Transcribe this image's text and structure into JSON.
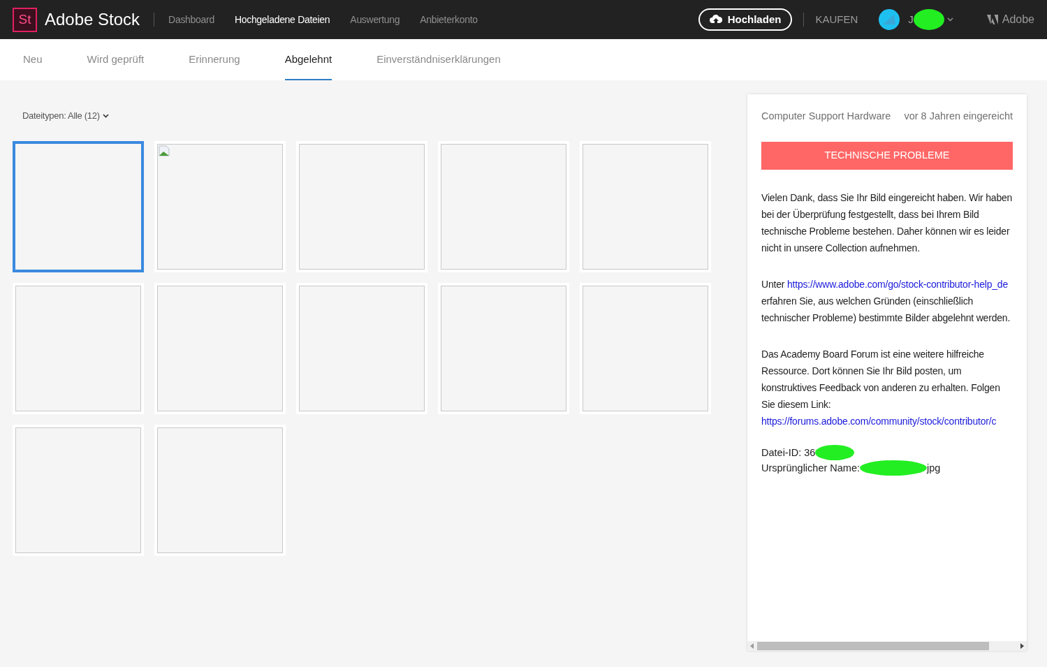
{
  "header": {
    "logo_mark": "St",
    "brand": "Adobe Stock",
    "nav": [
      {
        "label": "Dashboard",
        "selected": false
      },
      {
        "label": "Hochgeladene Dateien",
        "selected": true
      },
      {
        "label": "Auswertung",
        "selected": false
      },
      {
        "label": "Anbieterkonto",
        "selected": false
      }
    ],
    "upload_button": "Hochladen",
    "buy_link": "KAUFEN",
    "user_initial": "J",
    "adobe_link": "Adobe"
  },
  "tabs": [
    {
      "label": "Neu",
      "selected": false
    },
    {
      "label": "Wird geprüft",
      "selected": false
    },
    {
      "label": "Erinnerung",
      "selected": false
    },
    {
      "label": "Abgelehnt",
      "selected": true
    },
    {
      "label": "Einverständniserklärungen",
      "selected": false
    }
  ],
  "filter": "Dateitypen: Alle (12)",
  "tiles": [
    {
      "selected": true,
      "broken_image": false
    },
    {
      "selected": false,
      "broken_image": true
    },
    {
      "selected": false,
      "broken_image": false
    },
    {
      "selected": false,
      "broken_image": false
    },
    {
      "selected": false,
      "broken_image": false
    },
    {
      "selected": false,
      "broken_image": false
    },
    {
      "selected": false,
      "broken_image": false
    },
    {
      "selected": false,
      "broken_image": false
    },
    {
      "selected": false,
      "broken_image": false
    },
    {
      "selected": false,
      "broken_image": false
    },
    {
      "selected": false,
      "broken_image": false
    },
    {
      "selected": false,
      "broken_image": false
    }
  ],
  "detail": {
    "category": "Computer Support Hardware",
    "submitted": "vor 8 Jahren eingereicht",
    "reason": "TECHNISCHE PROBLEME",
    "paragraphs": [
      [
        {
          "kind": "text",
          "text": "Vielen Dank, dass Sie Ihr Bild eingereicht haben. Wir haben bei der Überprüfung festgestellt, dass bei Ihrem Bild technische Probleme bestehen. Daher können wir es leider nicht in unsere Collection aufnehmen."
        }
      ],
      [
        {
          "kind": "text",
          "text": "Unter "
        },
        {
          "kind": "link",
          "text": "https://www.adobe.com/go/stock-contributor-help_de"
        },
        {
          "kind": "text",
          "text": " erfahren Sie, aus welchen Gründen (einschließlich technischer Probleme) bestimmte Bilder abgelehnt werden."
        }
      ],
      [
        {
          "kind": "text",
          "text": "Das Academy Board Forum ist eine weitere hilfreiche Ressource. Dort können Sie Ihr Bild posten, um konstruktives Feedback von anderen zu erhalten. Folgen Sie diesem Link: "
        },
        {
          "kind": "link",
          "text": "https://forums.adobe.com/community/stock/contributor/c"
        }
      ]
    ],
    "file_id": "Datei-ID: 36",
    "original_name_label": "Ursprünglicher Name:",
    "original_name_suffix": "jpg"
  }
}
